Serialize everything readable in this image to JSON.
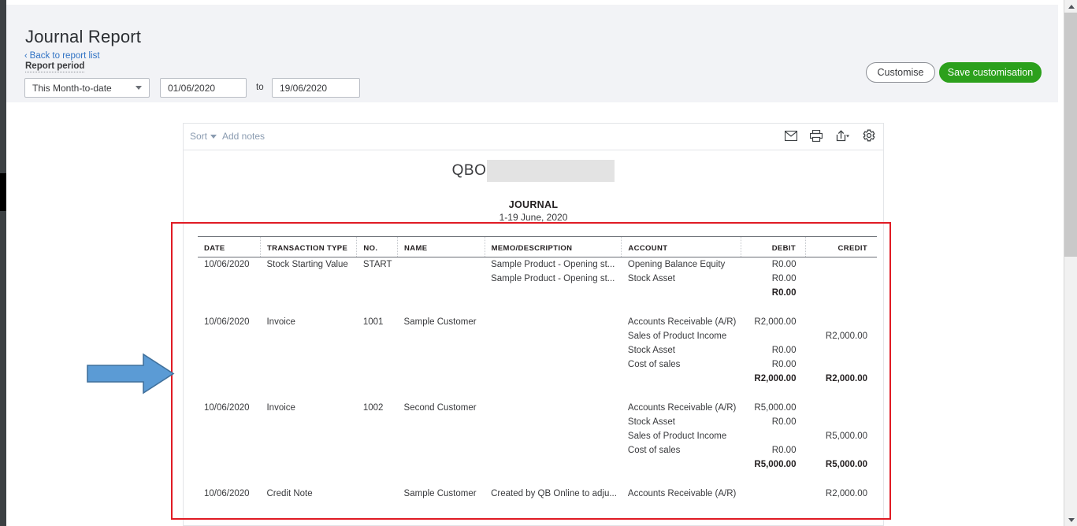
{
  "header": {
    "title": "Journal Report",
    "back_link": "Back to report list",
    "back_chevron": "‹",
    "report_period_label": "Report period",
    "period_select_value": "This Month-to-date",
    "date_from": "01/06/2020",
    "to_label": "to",
    "date_to": "19/06/2020",
    "customise_button": "Customise",
    "save_customisation_button": "Save customisation",
    "accent_green": "#2ca01c",
    "link_blue": "#2f72c4"
  },
  "toolbar": {
    "sort_label": "Sort",
    "add_notes_label": "Add notes",
    "icons": [
      "email-icon",
      "print-icon",
      "export-icon",
      "settings-icon"
    ]
  },
  "report": {
    "company_name": "QBO",
    "company_redacted": true,
    "title": "JOURNAL",
    "date_range": "1-19 June, 2020",
    "columns": [
      "DATE",
      "TRANSACTION TYPE",
      "NO.",
      "NAME",
      "MEMO/DESCRIPTION",
      "ACCOUNT",
      "DEBIT",
      "CREDIT"
    ],
    "groups": [
      {
        "date": "10/06/2020",
        "transaction_type": "Stock Starting Value",
        "no": "START",
        "name": "",
        "lines": [
          {
            "memo": "Sample Product - Opening st...",
            "account": "Opening Balance Equity",
            "debit": "R0.00",
            "credit": ""
          },
          {
            "memo": "Sample Product - Opening st...",
            "account": "Stock Asset",
            "debit": "R0.00",
            "credit": ""
          }
        ],
        "total_debit": "R0.00",
        "total_credit": ""
      },
      {
        "date": "10/06/2020",
        "transaction_type": "Invoice",
        "no": "1001",
        "name": "Sample Customer",
        "lines": [
          {
            "memo": "",
            "account": "Accounts Receivable (A/R)",
            "debit": "R2,000.00",
            "credit": ""
          },
          {
            "memo": "",
            "account": "Sales of Product Income",
            "debit": "",
            "credit": "R2,000.00"
          },
          {
            "memo": "",
            "account": "Stock Asset",
            "debit": "R0.00",
            "credit": ""
          },
          {
            "memo": "",
            "account": "Cost of sales",
            "debit": "R0.00",
            "credit": ""
          }
        ],
        "total_debit": "R2,000.00",
        "total_credit": "R2,000.00"
      },
      {
        "date": "10/06/2020",
        "transaction_type": "Invoice",
        "no": "1002",
        "name": "Second Customer",
        "lines": [
          {
            "memo": "",
            "account": "Accounts Receivable (A/R)",
            "debit": "R5,000.00",
            "credit": ""
          },
          {
            "memo": "",
            "account": "Stock Asset",
            "debit": "R0.00",
            "credit": ""
          },
          {
            "memo": "",
            "account": "Sales of Product Income",
            "debit": "",
            "credit": "R5,000.00"
          },
          {
            "memo": "",
            "account": "Cost of sales",
            "debit": "R0.00",
            "credit": ""
          }
        ],
        "total_debit": "R5,000.00",
        "total_credit": "R5,000.00"
      },
      {
        "date": "10/06/2020",
        "transaction_type": "Credit Note",
        "no": "",
        "name": "Sample Customer",
        "lines": [
          {
            "memo": "Created by QB Online to adju...",
            "account": "Accounts Receivable (A/R)",
            "debit": "",
            "credit": "R2,000.00"
          }
        ],
        "total_debit": "",
        "total_credit": ""
      }
    ]
  },
  "annotations": {
    "highlight_rect_color": "#e01b24",
    "arrow_fill": "#5b9bd5",
    "arrow_stroke": "#41719c"
  }
}
